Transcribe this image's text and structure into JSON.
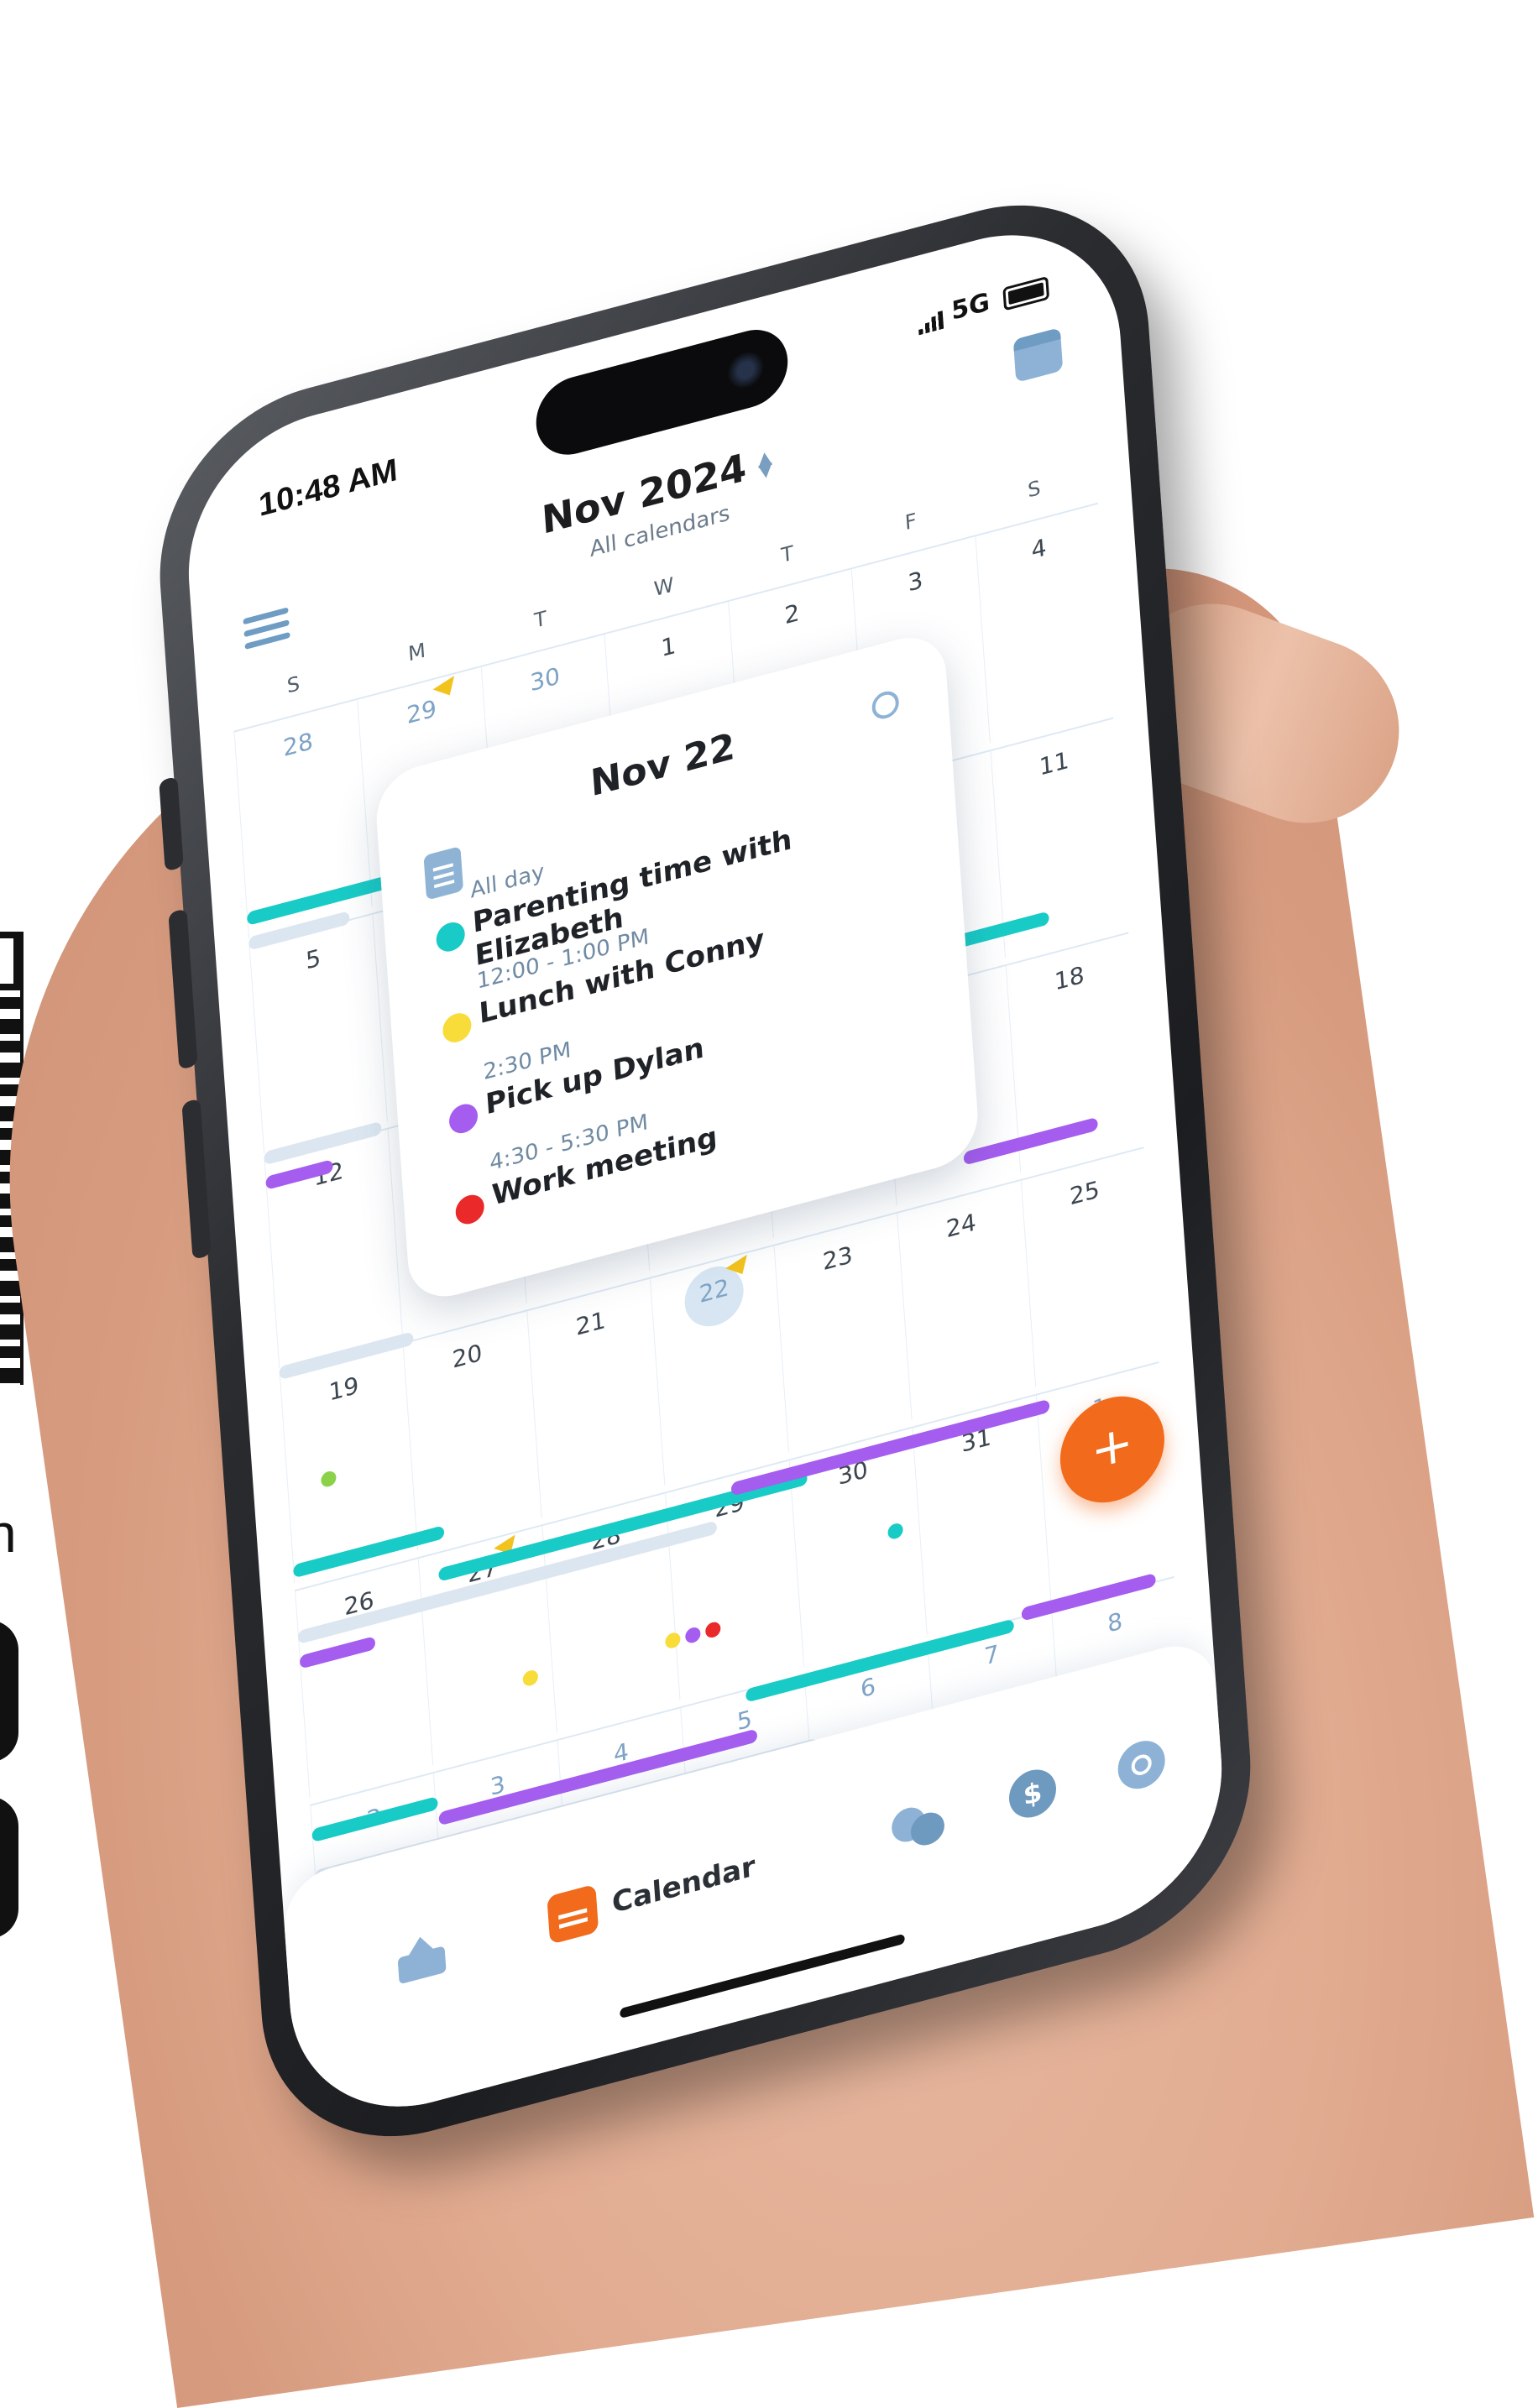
{
  "status": {
    "time": "10:48 AM",
    "network": "5G"
  },
  "header": {
    "title": "Nov 2024",
    "subtitle": "All calendars"
  },
  "weekdays": [
    "S",
    "M",
    "T",
    "W",
    "T",
    "F",
    "S"
  ],
  "weeks": [
    [
      "28",
      "29",
      "30",
      "1",
      "2",
      "3",
      "4"
    ],
    [
      "5",
      "",
      "",
      "",
      "",
      "",
      "11"
    ],
    [
      "12",
      "",
      "",
      "",
      "",
      "",
      "18"
    ],
    [
      "19",
      "20",
      "21",
      "22",
      "23",
      "24",
      "25"
    ],
    [
      "26",
      "27",
      "28",
      "29",
      "30",
      "31",
      "1"
    ],
    [
      "2",
      "3",
      "4",
      "5",
      "6",
      "7",
      "8"
    ]
  ],
  "popup": {
    "title": "Nov 22",
    "events": [
      {
        "time": "All day",
        "title": "Parenting time with Elizabeth",
        "color": "#19cbc6"
      },
      {
        "time": "12:00 - 1:00 PM",
        "title": "Lunch with Conny",
        "color": "#f8dc3a"
      },
      {
        "time": "2:30 PM",
        "title": "Pick up Dylan",
        "color": "#a55df0"
      },
      {
        "time": "4:30 - 5:30 PM",
        "title": "Work meeting",
        "color": "#ea2a2a"
      }
    ]
  },
  "fab": {
    "label": "+"
  },
  "nav": {
    "active_label": "Calendar",
    "money_symbol": "$"
  },
  "colors": {
    "accent": "#f26a1b",
    "teal": "#19cbc6",
    "purple": "#a55df0",
    "muted_blue": "#8db2d6"
  },
  "icons": {
    "menu": "menu-icon",
    "calendar_top": "calendar-icon",
    "notes": "notes-icon",
    "edit": "edit-icon",
    "home": "home-icon",
    "calendar_tab": "calendar-icon",
    "chat": "chat-icon",
    "money": "dollar-icon",
    "more": "more-icon"
  }
}
